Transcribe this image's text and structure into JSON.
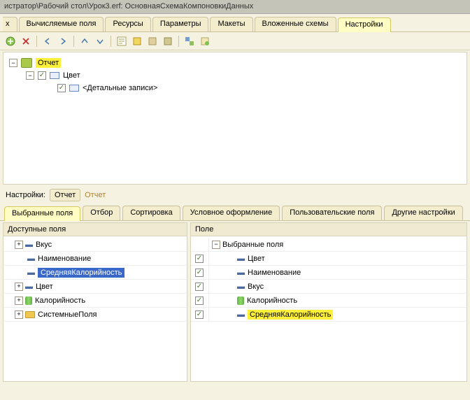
{
  "window": {
    "title": "истратор\\Рабочий стол\\Урок3.erf: ОсновнаяСхемаКомпоновкиДанных"
  },
  "top_tabs": {
    "items": [
      {
        "label": "х",
        "partial": true
      },
      {
        "label": "Вычисляемые поля"
      },
      {
        "label": "Ресурсы"
      },
      {
        "label": "Параметры"
      },
      {
        "label": "Макеты"
      },
      {
        "label": "Вложенные схемы"
      },
      {
        "label": "Настройки",
        "active": true
      }
    ]
  },
  "tree": {
    "root": {
      "label": "Отчет"
    },
    "group": {
      "label": "Цвет"
    },
    "detail": {
      "label": "<Детальные записи>"
    }
  },
  "settings_bar": {
    "label": "Настройки:",
    "btn": "Отчет",
    "link": "Отчет"
  },
  "sub_tabs": {
    "items": [
      {
        "label": "Выбранные поля",
        "active": true
      },
      {
        "label": "Отбор"
      },
      {
        "label": "Сортировка"
      },
      {
        "label": "Условное оформление"
      },
      {
        "label": "Пользовательские поля"
      },
      {
        "label": "Другие настройки"
      }
    ]
  },
  "avail": {
    "header": "Доступные поля",
    "items": [
      {
        "label": "Вкус",
        "expandable": true
      },
      {
        "label": "Наименование"
      },
      {
        "label": "СредняяКалорийность",
        "selected": true
      },
      {
        "label": "Цвет",
        "expandable": true
      },
      {
        "label": "Калорийность",
        "expandable": true,
        "icon": "cyl"
      },
      {
        "label": "СистемныеПоля",
        "expandable": true,
        "icon": "folder"
      }
    ]
  },
  "selected": {
    "header": "Поле",
    "root": "Выбранные поля",
    "items": [
      {
        "label": "Цвет"
      },
      {
        "label": "Наименование"
      },
      {
        "label": "Вкус"
      },
      {
        "label": "Калорийность",
        "icon": "cyl"
      },
      {
        "label": "СредняяКалорийность",
        "highlight": true
      }
    ]
  }
}
